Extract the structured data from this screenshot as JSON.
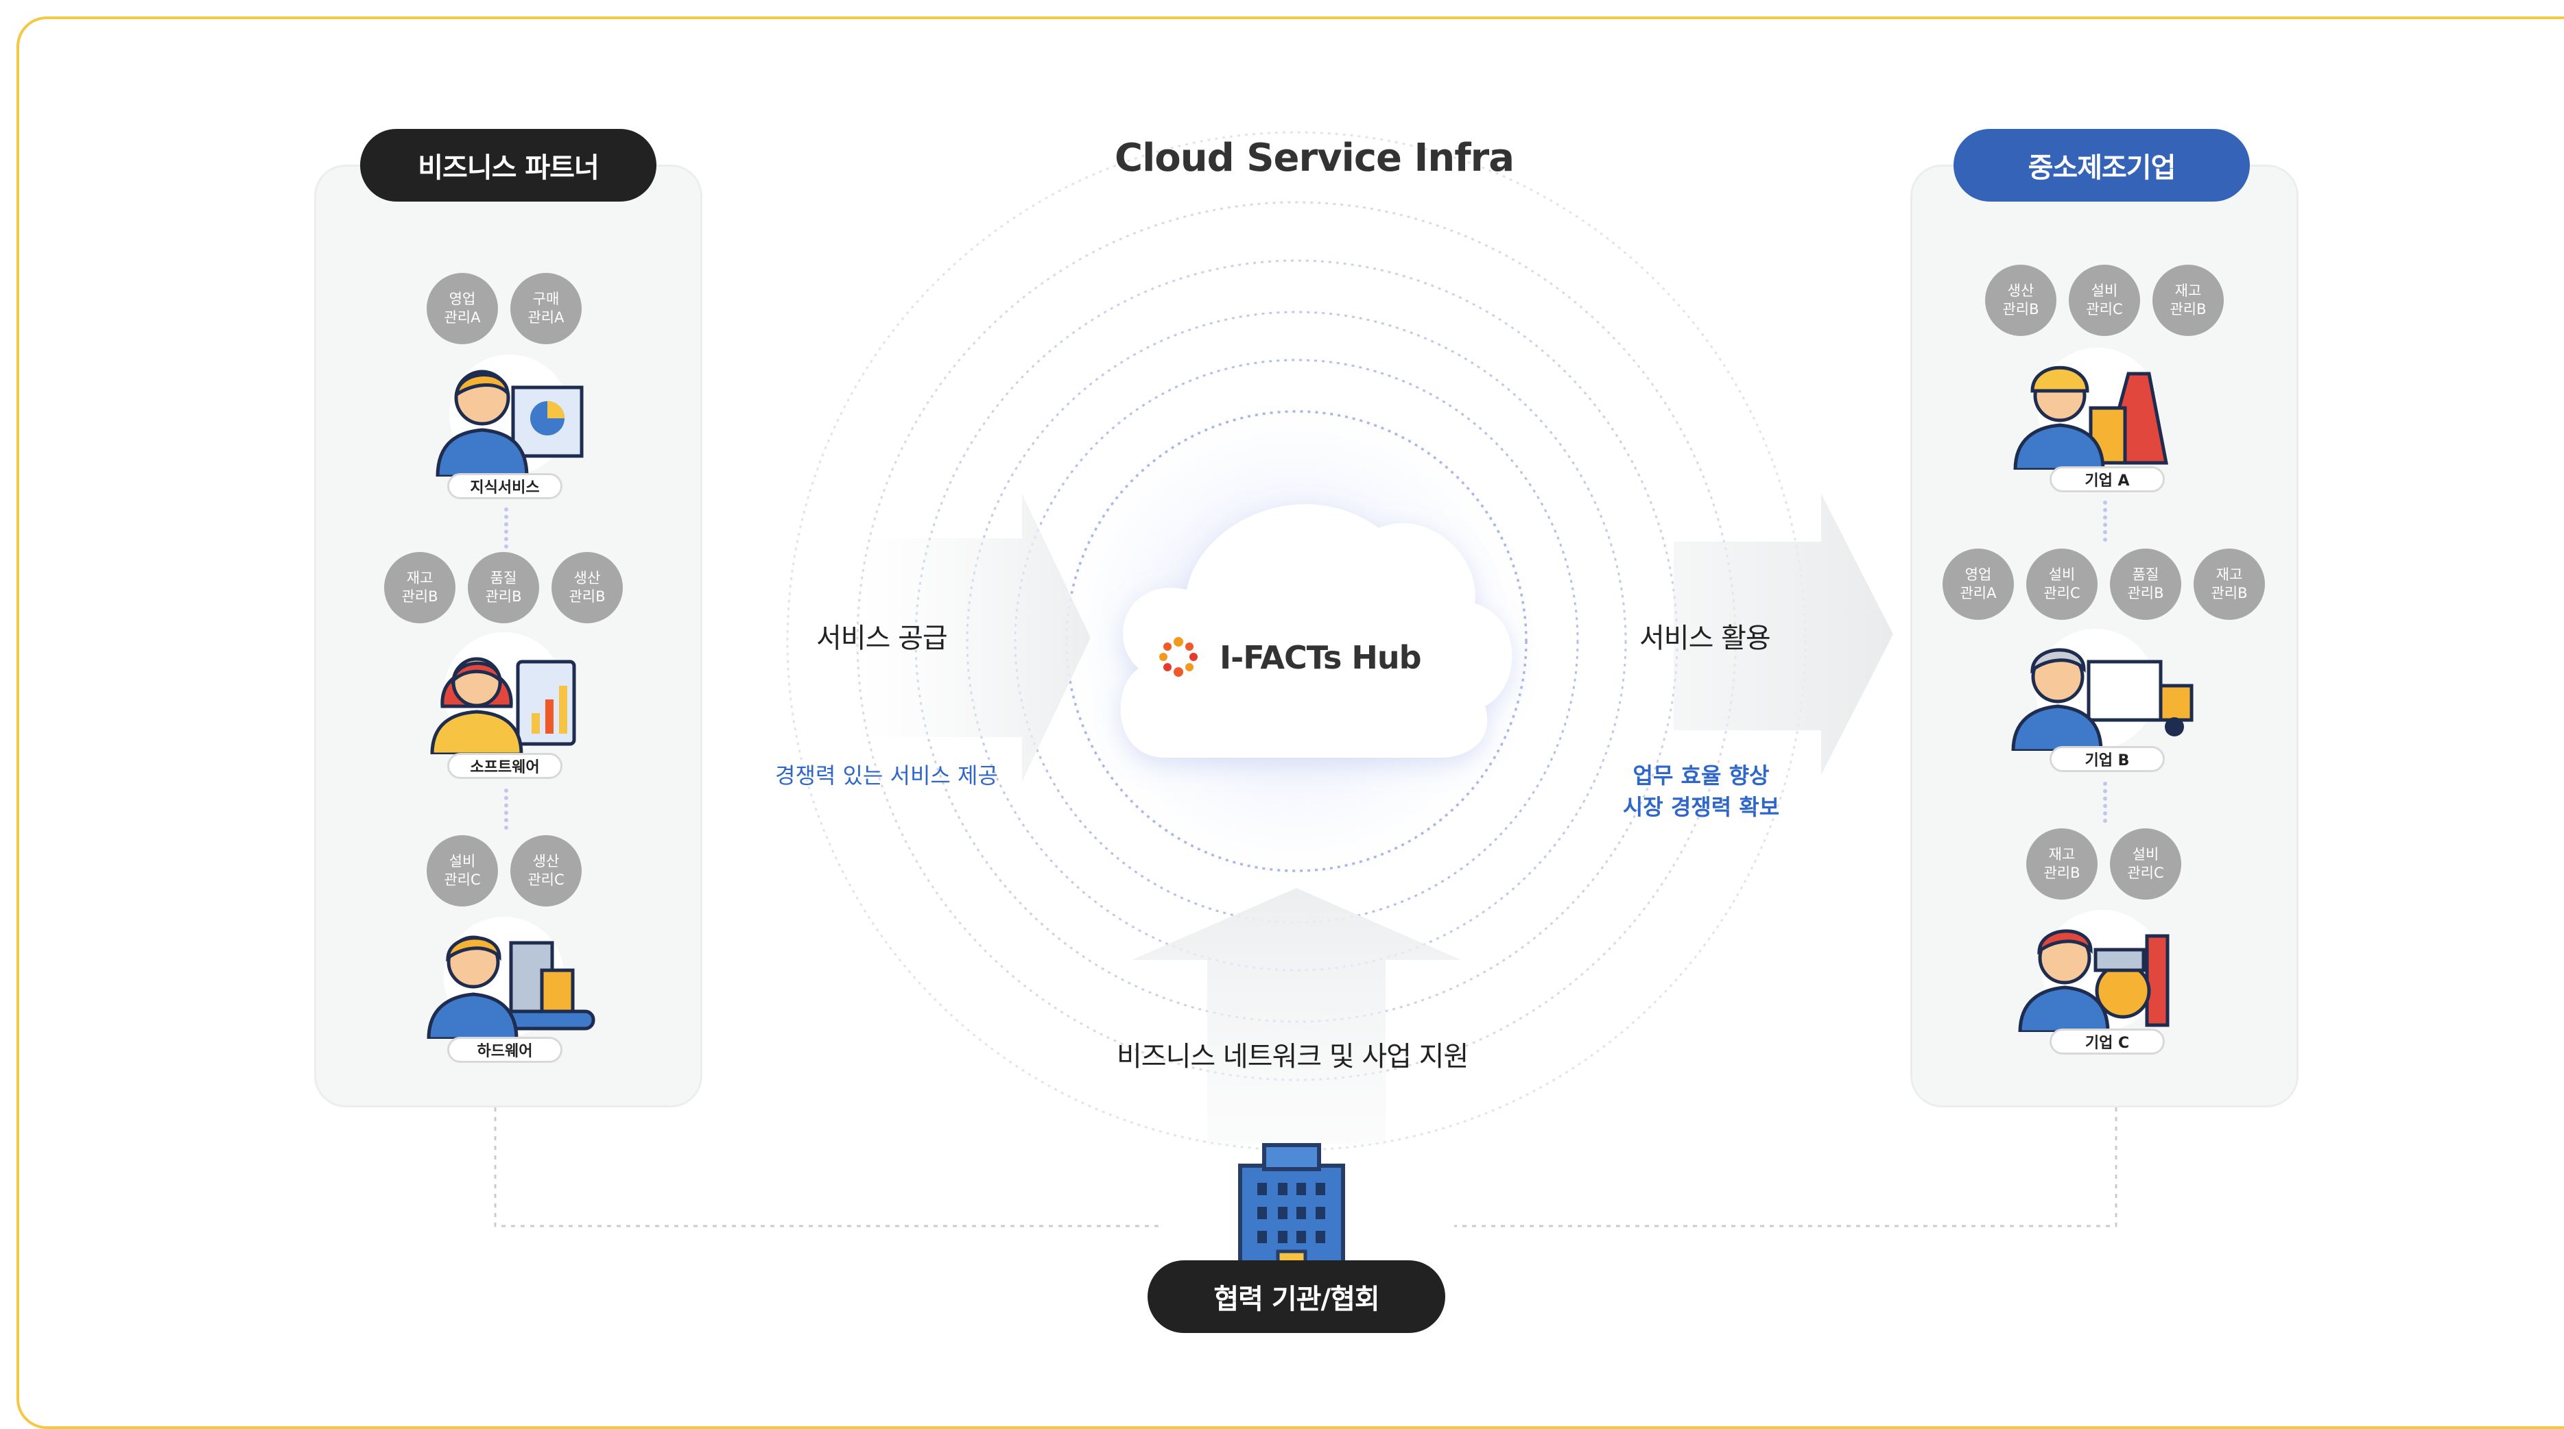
{
  "partners": {
    "title": "비즈니스 파트너",
    "groups": [
      {
        "tags": [
          "영업\n관리A",
          "구매\n관리A"
        ],
        "label": "지식서비스"
      },
      {
        "tags": [
          "재고\n관리B",
          "품질\n관리B",
          "생산\n관리B"
        ],
        "label": "소프트웨어"
      },
      {
        "tags": [
          "설비\n관리C",
          "생산\n관리C"
        ],
        "label": "하드웨어"
      }
    ]
  },
  "manufacturers": {
    "title": "중소제조기업",
    "groups": [
      {
        "tags": [
          "생산\n관리B",
          "설비\n관리C",
          "재고\n관리B"
        ],
        "label": "기업 A"
      },
      {
        "tags": [
          "영업\n관리A",
          "설비\n관리C",
          "품질\n관리B",
          "재고\n관리B"
        ],
        "label": "기업 B"
      },
      {
        "tags": [
          "재고\n관리B",
          "설비\n관리C"
        ],
        "label": "기업 C"
      }
    ]
  },
  "center": {
    "infra_title": "Cloud Service Infra",
    "hub_name": "I-FACTs Hub",
    "supply_label": "서비스 공급",
    "supply_desc": "경쟁력 있는 서비스 제공",
    "use_label": "서비스 활용",
    "use_desc": "업무 효율 향상\n시장 경쟁력 확보",
    "support_label": "비즈니스 네트워크 및 사업 지원"
  },
  "bottom": {
    "label": "협력 기관/협회"
  },
  "colors": {
    "dark_pill": "#222222",
    "blue_pill": "#3563b8",
    "accent_text": "#2f67c9",
    "frame": "#f5c842",
    "tag": "#a7a7a7"
  }
}
